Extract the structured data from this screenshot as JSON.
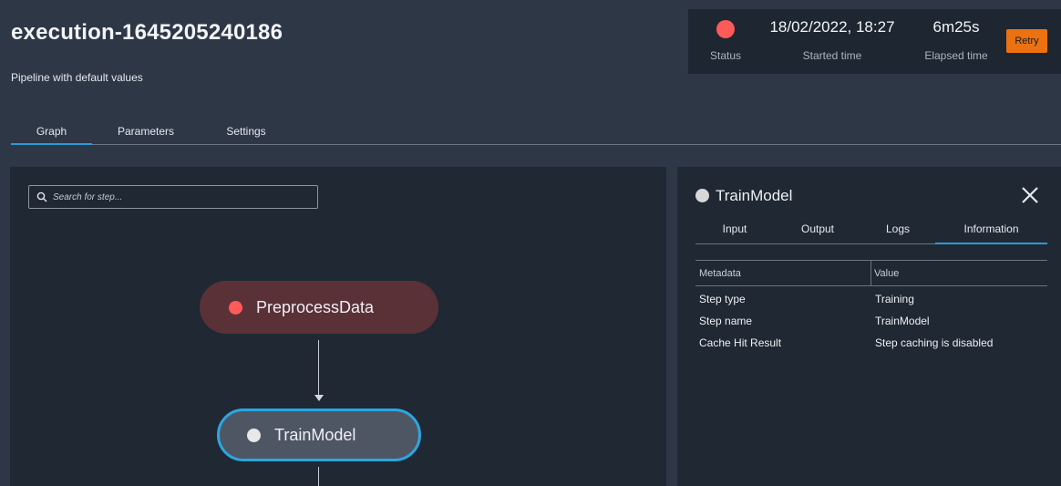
{
  "header": {
    "title": "execution-1645205240186",
    "subtitle": "Pipeline with default values"
  },
  "status_panel": {
    "status_label": "Status",
    "status_color": "#ff5a5a",
    "started_time": "18/02/2022, 18:27",
    "started_time_label": "Started time",
    "elapsed_time": "6m25s",
    "elapsed_time_label": "Elapsed time",
    "retry_label": "Retry"
  },
  "tabs": [
    {
      "label": "Graph",
      "active": true
    },
    {
      "label": "Parameters",
      "active": false
    },
    {
      "label": "Settings",
      "active": false
    }
  ],
  "graph": {
    "search_placeholder": "Search for step...",
    "nodes": [
      {
        "name": "PreprocessData",
        "status_color": "#ff5a5a"
      },
      {
        "name": "TrainModel",
        "status_color": "#e8e8e8",
        "selected": true
      }
    ]
  },
  "detail": {
    "title": "TrainModel",
    "tabs": [
      {
        "label": "Input"
      },
      {
        "label": "Output"
      },
      {
        "label": "Logs"
      },
      {
        "label": "Information",
        "active": true
      }
    ],
    "table": {
      "headers": [
        "Metadata",
        "Value"
      ],
      "rows": [
        [
          "Step type",
          "Training"
        ],
        [
          "Step name",
          "TrainModel"
        ],
        [
          "Cache Hit Result",
          "Step caching is disabled"
        ]
      ]
    }
  },
  "colors": {
    "accent": "#2a9bd8",
    "retry": "#ec7211",
    "failed": "#ff5a5a"
  }
}
